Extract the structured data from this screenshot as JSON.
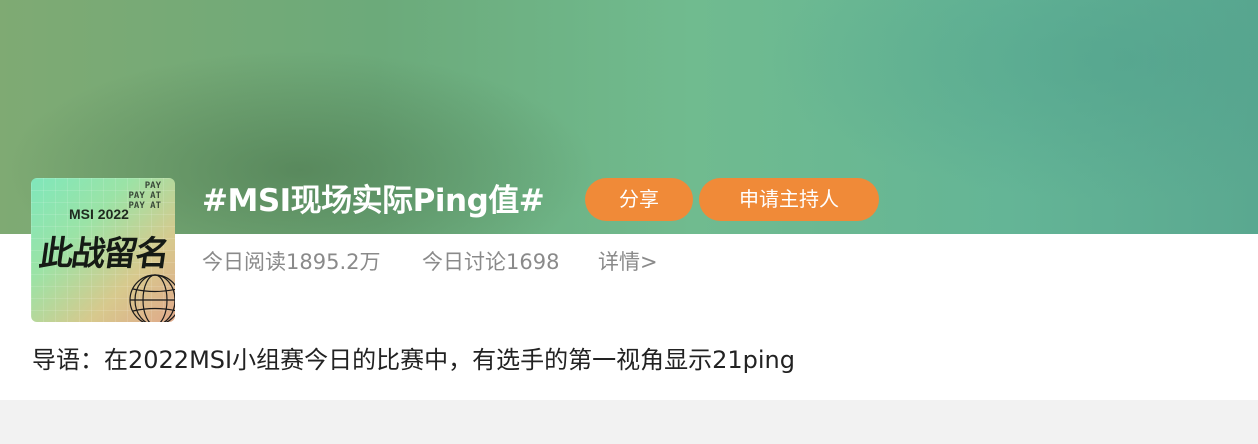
{
  "banner": {
    "colors": {
      "start": "#7faa73",
      "end": "#5aa890"
    }
  },
  "cover": {
    "pay_lines": "PAY\nPAY AT\nPAY AT",
    "event": "MSI 2022",
    "slogan": "此战留名"
  },
  "topic": {
    "title": "#MSI现场实际Ping值#",
    "share_label": "分享",
    "host_label": "申请主持人",
    "accent_color": "#f08a38"
  },
  "stats": {
    "reads": "今日阅读1895.2万",
    "discussions": "今日讨论1698",
    "detail_link": "详情>"
  },
  "intro": {
    "text": "导语：在2022MSI小组赛今日的比赛中，有选手的第一视角显示21ping"
  }
}
